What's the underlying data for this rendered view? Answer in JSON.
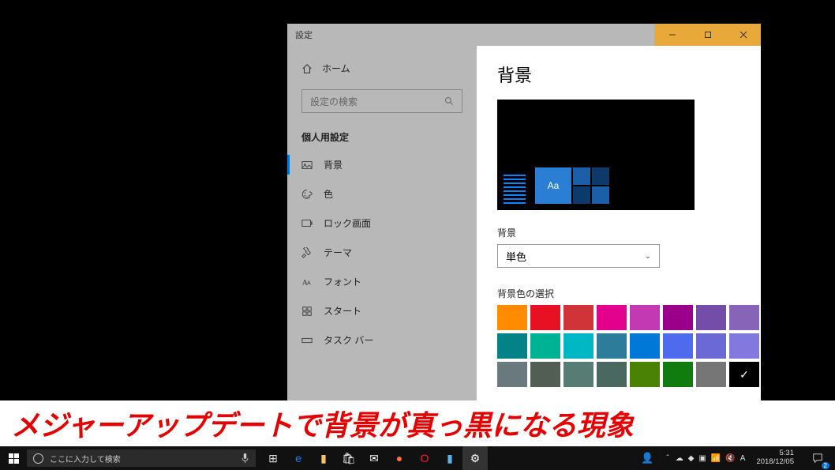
{
  "window": {
    "title": "設定"
  },
  "sidebar": {
    "home": "ホーム",
    "search_placeholder": "設定の検索",
    "section": "個人用設定",
    "items": [
      {
        "label": "背景",
        "icon": "picture-icon",
        "active": true
      },
      {
        "label": "色",
        "icon": "palette-icon",
        "active": false
      },
      {
        "label": "ロック画面",
        "icon": "lock-screen-icon",
        "active": false
      },
      {
        "label": "テーマ",
        "icon": "theme-icon",
        "active": false
      },
      {
        "label": "フォント",
        "icon": "font-icon",
        "active": false
      },
      {
        "label": "スタート",
        "icon": "start-icon",
        "active": false
      },
      {
        "label": "タスク バー",
        "icon": "taskbar-icon",
        "active": false
      }
    ]
  },
  "content": {
    "heading": "背景",
    "preview_tile_text": "Aa",
    "bg_label": "背景",
    "bg_dropdown_value": "単色",
    "color_section_label": "背景色の選択",
    "swatches": [
      "#ff8c00",
      "#e81123",
      "#d13438",
      "#e3008c",
      "#c239b3",
      "#9a0089",
      "#744da9",
      "#8764b8",
      "#038387",
      "#00b294",
      "#00b7c3",
      "#2d7d9a",
      "#0078d7",
      "#4f6bed",
      "#6b69d6",
      "#8378de",
      "#69797e",
      "#525e54",
      "#567c73",
      "#486860",
      "#498205",
      "#107c10",
      "#767676",
      "#000000"
    ],
    "selected_swatch_index": 23
  },
  "banner": {
    "text": "メジャーアップデートで背景が真っ黒になる現象"
  },
  "taskbar": {
    "search_placeholder": "ここに入力して検索",
    "pinned": [
      {
        "name": "task-view-icon",
        "glyph": "⊞"
      },
      {
        "name": "edge-icon",
        "color": "#0a84ff",
        "glyph": "e"
      },
      {
        "name": "file-explorer-icon",
        "color": "#f7c36b",
        "glyph": "▮"
      },
      {
        "name": "store-icon",
        "color": "#fff",
        "glyph": "🛍"
      },
      {
        "name": "mail-icon",
        "color": "#fff",
        "glyph": "✉"
      },
      {
        "name": "firefox-icon",
        "color": "#ff7139",
        "glyph": "●"
      },
      {
        "name": "opera-icon",
        "color": "#ff1b2d",
        "glyph": "O"
      },
      {
        "name": "notepad-icon",
        "color": "#5bb0e8",
        "glyph": "▮"
      },
      {
        "name": "settings-icon",
        "color": "#fff",
        "glyph": "⚙",
        "active": true
      }
    ],
    "tray": {
      "people": "people-icon",
      "up": "chevron-up-icon",
      "items": [
        "onedrive-icon",
        "app-icon",
        "app2-icon",
        "network-icon",
        "volume-icon",
        "ime-icon"
      ],
      "ime_text": "A",
      "time": "5:31",
      "date": "2018/12/05",
      "action_badge": "2"
    }
  }
}
